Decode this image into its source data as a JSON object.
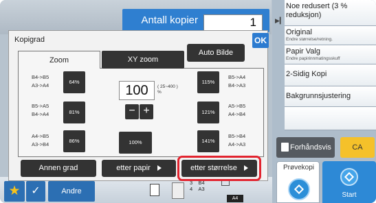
{
  "header": {
    "copies_label": "Antall kopier",
    "copies_value": "1"
  },
  "sidebar": {
    "items": [
      {
        "title": "Noe redusert (3 % reduksjon)",
        "sub": ""
      },
      {
        "title": "Original",
        "sub": "Endre størrelse/retning."
      },
      {
        "title": "Papir Valg",
        "sub": "Endre papirinnmatingsskuff"
      },
      {
        "title": "2-Sidig Kopi",
        "sub": ""
      },
      {
        "title": "Bakgrunnsjustering",
        "sub": ""
      }
    ],
    "preview_label": "Forhåndsvis",
    "ca_label": "CA",
    "provekopi_label": "Prøvekopi",
    "start_label": "Start"
  },
  "dialog": {
    "title": "Kopigrad",
    "ok_label": "OK",
    "tabs": {
      "zoom": "Zoom",
      "xy": "XY zoom"
    },
    "auto_label": "Auto Bilde",
    "ratio_value": "100",
    "range_label": "( 25~400 )",
    "range_unit": "%",
    "minus": "−",
    "plus": "+",
    "presets": {
      "r64": {
        "label_top": "B4->B5",
        "label_bottom": "A3->A4",
        "value": "64%"
      },
      "r81": {
        "label_top": "B5->A5",
        "label_bottom": "B4->A4",
        "value": "81%"
      },
      "r86": {
        "label_top": "A4->B5",
        "label_bottom": "A3->B4",
        "value": "86%"
      },
      "r100": {
        "value": "100%"
      },
      "r115": {
        "label_top": "B5->A4",
        "label_bottom": "B4->A3",
        "value": "115%"
      },
      "r121": {
        "label_top": "A5->B5",
        "label_bottom": "A4->B4",
        "value": "121%"
      },
      "r141": {
        "label_top": "B5->B4",
        "label_bottom": "A4->A3",
        "value": "141%"
      }
    },
    "buttons": {
      "other": "Annen grad",
      "by_paper": "etter papir",
      "by_size": "etter størrelse"
    }
  },
  "bottombar": {
    "star": "★",
    "check": "✓",
    "andre": "Andre",
    "tray": {
      "row1_num": "3",
      "row1_size": "B4",
      "row2_num": "4",
      "row2_size": "A3",
      "current": "A4"
    }
  },
  "colors": {
    "accent_blue": "#2c7bd0",
    "highlight_red": "#e2232e",
    "ca_yellow": "#f5c12a"
  }
}
